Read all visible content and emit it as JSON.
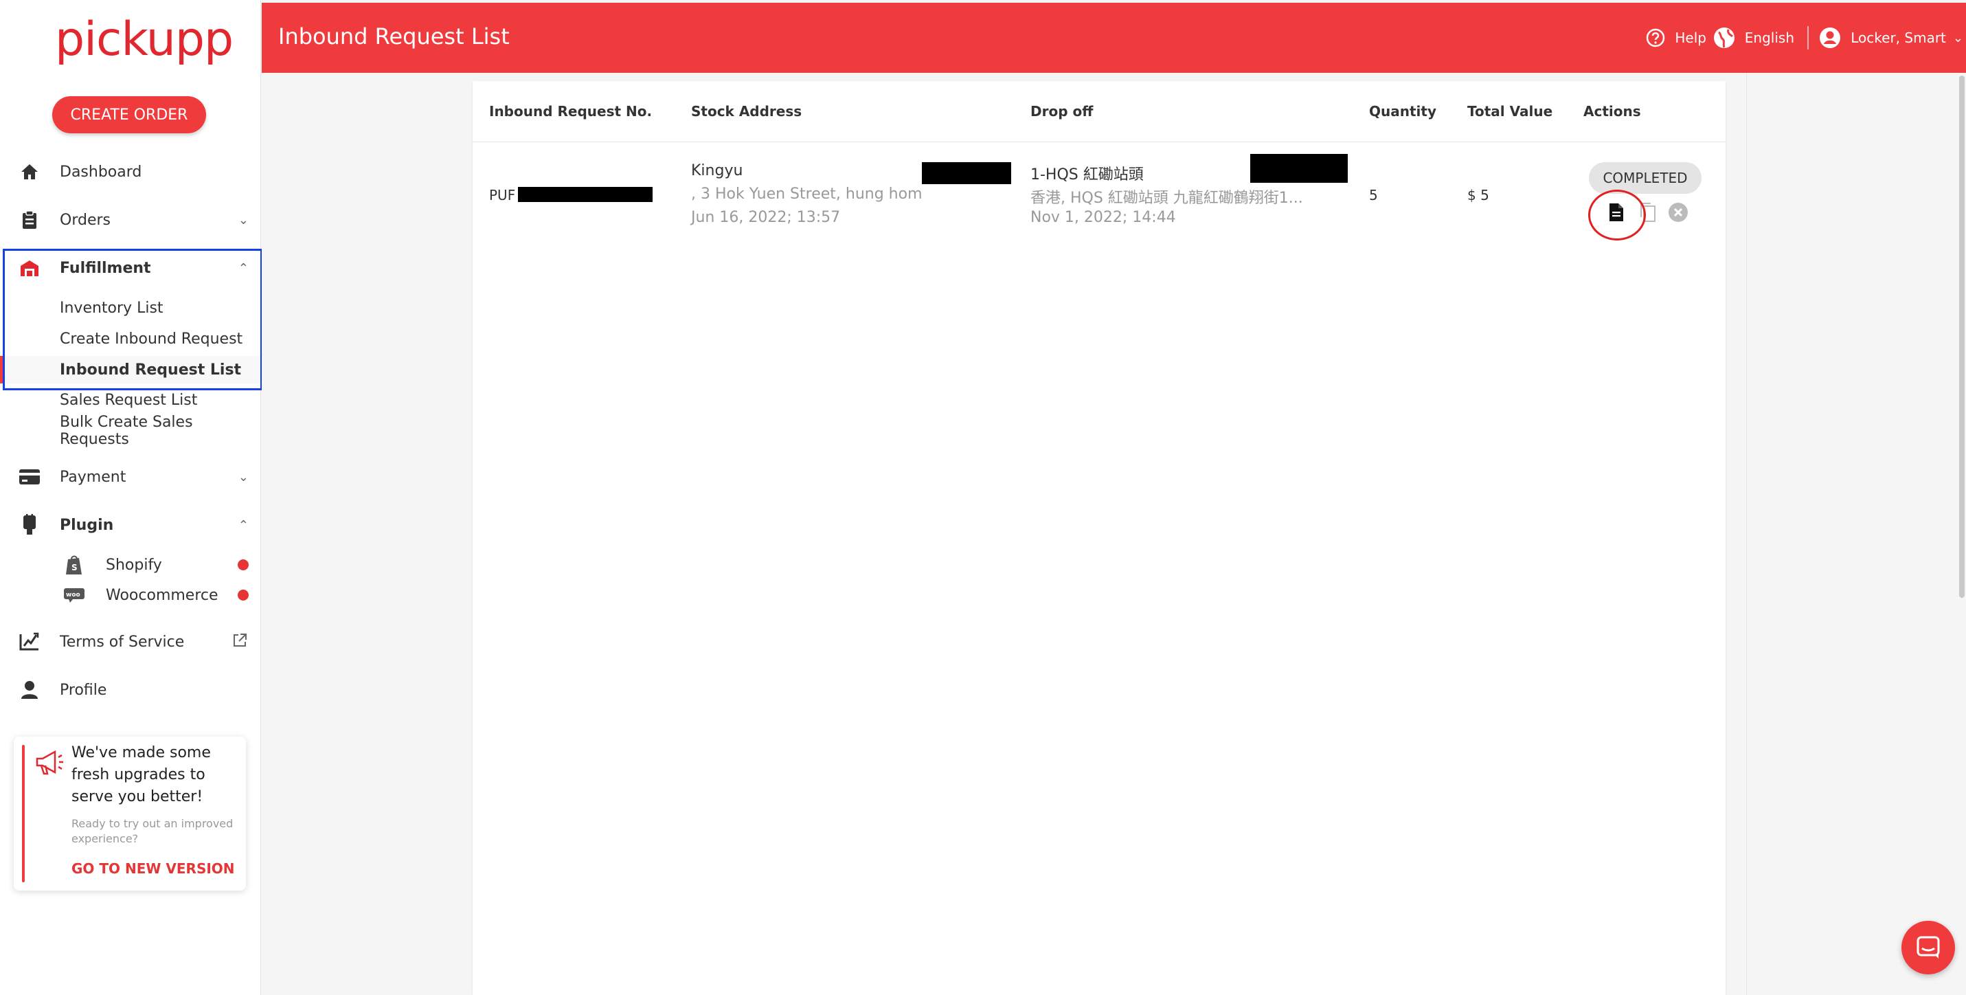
{
  "brand": {
    "logo_text": "pickupp",
    "accent": "#ef3b3d"
  },
  "sidebar": {
    "create_button": "CREATE ORDER",
    "nav": {
      "dashboard": "Dashboard",
      "orders": "Orders",
      "fulfillment": "Fulfillment",
      "payment": "Payment",
      "plugin": "Plugin",
      "terms": "Terms of Service",
      "profile": "Profile"
    },
    "fulfillment_items": [
      "Inventory List",
      "Create Inbound Request",
      "Inbound Request List",
      "Sales Request List",
      "Bulk Create Sales Requests"
    ],
    "plugin_items": [
      "Shopify",
      "Woocommerce"
    ],
    "promo": {
      "title": "We've made some fresh upgrades to serve you better!",
      "subtitle": "Ready to try out an improved experience?",
      "link": "GO TO NEW VERSION"
    }
  },
  "header": {
    "title": "Inbound Request List",
    "help": "Help",
    "language": "English",
    "user": "Locker, Smart"
  },
  "table": {
    "columns": {
      "request_no": "Inbound Request No.",
      "stock_address": "Stock Address",
      "drop_off": "Drop off",
      "quantity": "Quantity",
      "total_value": "Total Value",
      "actions": "Actions"
    },
    "rows": [
      {
        "request_no": "PUF",
        "stock_name": "Kingyu",
        "stock_address": ", 3 Hok Yuen Street, hung hom",
        "stock_time": "Jun 16, 2022; 13:57",
        "drop_name": "1-HQS 紅磡站頭",
        "drop_address": "香港, HQS 紅磡站頭 九龍紅磡鶴翔街1...",
        "drop_time": "Nov 1, 2022; 14:44",
        "quantity": "5",
        "total_value": "$ 5",
        "status": "COMPLETED"
      }
    ]
  }
}
